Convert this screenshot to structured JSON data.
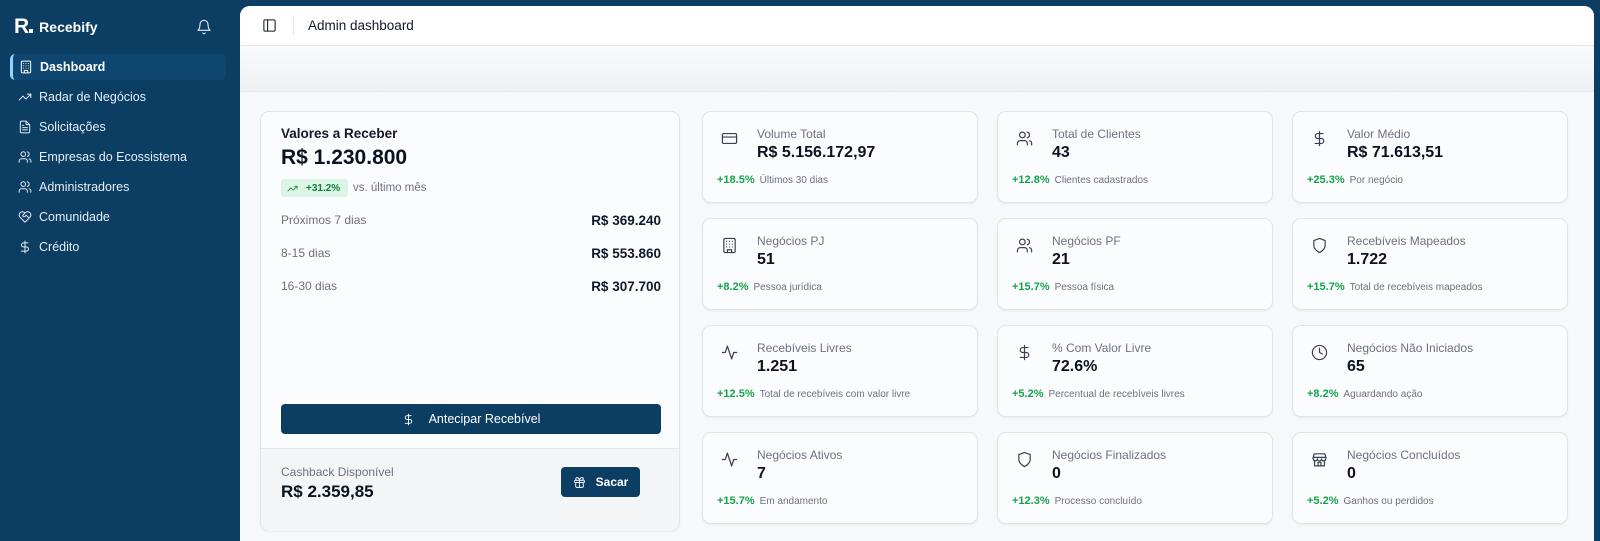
{
  "app": {
    "name": "Recebify",
    "logo_letter": "R"
  },
  "sidebar": {
    "items": [
      {
        "label": "Dashboard",
        "icon": "building-icon",
        "active": true
      },
      {
        "label": "Radar de Negócios",
        "icon": "trend-up-icon"
      },
      {
        "label": "Solicitações",
        "icon": "document-icon"
      },
      {
        "label": "Empresas do Ecossistema",
        "icon": "users-icon"
      },
      {
        "label": "Administradores",
        "icon": "users-icon"
      },
      {
        "label": "Comunidade",
        "icon": "handshake-heart-icon"
      },
      {
        "label": "Crédito",
        "icon": "dollar-icon"
      }
    ]
  },
  "header": {
    "title": "Admin dashboard"
  },
  "receivables": {
    "title": "Valores a Receber",
    "amount": "R$ 1.230.800",
    "delta": "+31.2%",
    "delta_note": "vs. último mês",
    "rows": [
      {
        "label": "Próximos 7 dias",
        "value": "R$ 369.240"
      },
      {
        "label": "8-15 dias",
        "value": "R$ 553.860"
      },
      {
        "label": "16-30 dias",
        "value": "R$ 307.700"
      }
    ],
    "button_label": "Antecipar Recebível",
    "cashback_label": "Cashback Disponível",
    "cashback_amount": "R$ 2.359,85",
    "withdraw_label": "Sacar"
  },
  "metrics": [
    {
      "title": "Volume Total",
      "value": "R$ 5.156.172,97",
      "delta": "+18.5%",
      "note": "Últimos 30 dias",
      "icon": "credit-card-icon"
    },
    {
      "title": "Total de Clientes",
      "value": "43",
      "delta": "+12.8%",
      "note": "Clientes cadastrados",
      "icon": "users-icon"
    },
    {
      "title": "Valor Médio",
      "value": "R$ 71.613,51",
      "delta": "+25.3%",
      "note": "Por negócio",
      "icon": "dollar-icon"
    },
    {
      "title": "Negócios PJ",
      "value": "51",
      "delta": "+8.2%",
      "note": "Pessoa jurídica",
      "icon": "building-icon"
    },
    {
      "title": "Negócios PF",
      "value": "21",
      "delta": "+15.7%",
      "note": "Pessoa física",
      "icon": "users-icon"
    },
    {
      "title": "Recebíveis Mapeados",
      "value": "1.722",
      "delta": "+15.7%",
      "note": "Total de recebíveis mapeados",
      "icon": "shield-icon"
    },
    {
      "title": "Recebíveis Livres",
      "value": "1.251",
      "delta": "+12.5%",
      "note": "Total de recebíveis com valor livre",
      "icon": "activity-icon"
    },
    {
      "title": "% Com Valor Livre",
      "value": "72.6%",
      "delta": "+5.2%",
      "note": "Percentual de recebíveis livres",
      "icon": "dollar-icon"
    },
    {
      "title": "Negócios Não Iniciados",
      "value": "65",
      "delta": "+8.2%",
      "note": "Aguardando ação",
      "icon": "clock-icon"
    },
    {
      "title": "Negócios Ativos",
      "value": "7",
      "delta": "+15.7%",
      "note": "Em andamento",
      "icon": "activity-icon"
    },
    {
      "title": "Negócios Finalizados",
      "value": "0",
      "delta": "+12.3%",
      "note": "Processo concluído",
      "icon": "shield-icon"
    },
    {
      "title": "Negócios Concluídos",
      "value": "0",
      "delta": "+5.2%",
      "note": "Ganhos ou perdidos",
      "icon": "store-icon"
    }
  ],
  "colors": {
    "brand": "#0c3d63",
    "positive": "#16a34a",
    "badge_bg": "#dcf5e6"
  }
}
